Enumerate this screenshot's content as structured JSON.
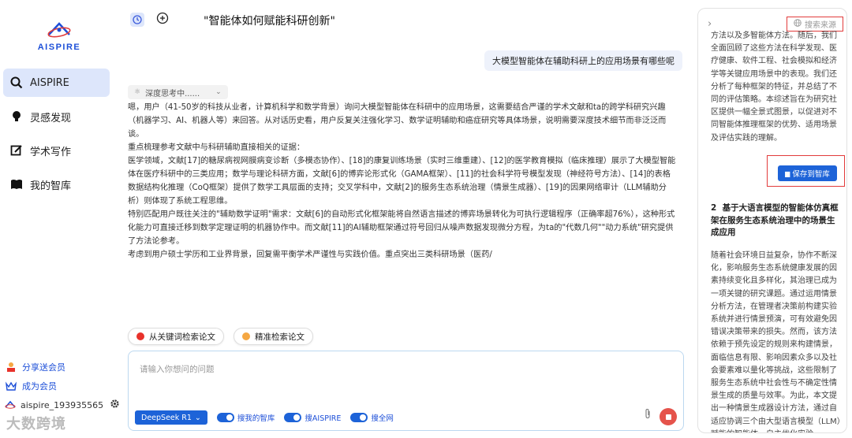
{
  "app": {
    "logo_text": "AISPIRE"
  },
  "sidebar": {
    "items": [
      {
        "label": "AISPIRE",
        "icon": "search-icon",
        "active": true
      },
      {
        "label": "灵感发现",
        "icon": "lightbulb-icon",
        "active": false
      },
      {
        "label": "学术写作",
        "icon": "edit-icon",
        "active": false
      },
      {
        "label": "我的智库",
        "icon": "book-icon",
        "active": false
      }
    ],
    "share": "分享送会员",
    "member": "成为会员",
    "username": "aispire_193935565"
  },
  "watermark": "大数跨境",
  "header": {
    "title": "\"智能体如何赋能科研创新\""
  },
  "chat": {
    "user_message": "大模型智能体在辅助科研上的应用场景有哪些呢",
    "thinking_label": "深度思考中......",
    "reasoning": [
      "嗯，用户（41-50岁的科技从业者，计算机科学和数学背景）询问大模型智能体在科研中的应用场景，这需要结合严谨的学术文献和ta的跨学科研究兴趣（机器学习、AI、机器人等）来回答。从对话历史看，用户反复关注强化学习、数学证明辅助和癌症研究等具体场景，说明需要深度技术细节而非泛泛而谈。",
      "重点梳理参考文献中与科研辅助直接相关的证据：",
      "医学领域，文献[17]的糖尿病视网膜病变诊断（多模态协作）、[18]的康复训练场景（实时三维重建）、[12]的医学教育模拟（临床推理）展示了大模型智能体在医疗科研中的三类应用；数学与理论科研方面，文献[6]的博弈论形式化（GAMA框架）、[11]的社会科学符号模型发现（神经符号方法）、[14]的表格数据结构化推理（CoQ框架）提供了数学工具层面的支持；交叉学科中，文献[2]的服务生态系统治理（情景生成器）、[19]的因果网络审计（LLM辅助分析）则体现了系统工程思维。",
      "特别匹配用户既往关注的\"辅助数学证明\"需求：文献[6]的自动形式化框架能将自然语言描述的博弈场景转化为可执行逻辑程序（正确率超76%），这种形式化能力可直接迁移到数学定理证明的机器协作中。而文献[11]的AI辅助框架通过符号回归从噪声数据发现微分方程，为ta的\"代数几何\"\"动力系统\"研究提供了方法论参考。",
      "考虑到用户硕士学历和工业界背景，回复需平衡学术严谨性与实践价值。重点突出三类科研场景（医药/"
    ],
    "chips": [
      {
        "label": "从关键词检索论文",
        "color": "#e8322b"
      },
      {
        "label": "精准检索论文",
        "color": "#f5a742"
      }
    ],
    "input_placeholder": "请输入你想问的问题",
    "model": "DeepSeek R1",
    "toggles": [
      "搜我的智库",
      "搜AISPIRE",
      "搜全网"
    ]
  },
  "panel": {
    "source_label": "搜索来源",
    "text1": "方法以及多智能体方法。随后，我们全面回顾了这些方法在科学发现、医疗健康、软件工程、社会模拟和经济学等关键应用场景中的表现。我们还分析了每种框架的特征，并总结了不同的评估策略。本综述旨在为研究社区提供一幅全景式图景，以促进对不同智能体推理框架的优势、适用场景及评估实践的理解。",
    "save_label": "保存到智库",
    "item_number": "2",
    "item_title": "基于大语言模型的智能体仿真框架在服务生态系统治理中的场景生成应用",
    "text2": "随着社会环境日益复杂，协作不断深化，影响服务生态系统健康发展的因素持续变化且多样化，其治理已成为一项关键的研究课题。通过运用情景分析方法，在管理者决策前构建实验系统并进行情景预演，可有效避免因错误决策带来的损失。然而，该方法依赖于预先设定的规则来构建情景，面临信息有限、影响因素众多以及社会要素难以量化等挑战，这些限制了服务生态系统中社会性与不确定性情景生成的质量与效率。为此，本文提出一种情景生成器设计方法，通过自适应协调三个由大型语言模型（LLM）赋能的智能体，自主优化实验"
  },
  "colors": {
    "accent": "#1d63d8",
    "active_nav": "#dde6fb",
    "highlight_box": "#e23b3b"
  }
}
